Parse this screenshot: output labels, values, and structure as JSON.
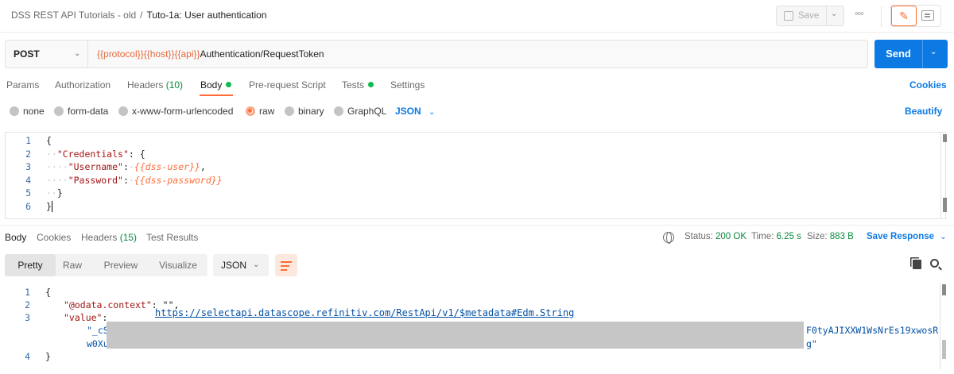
{
  "header": {
    "collection": "DSS REST API Tutorials - old",
    "separator": "/",
    "request_name": "Tuto-1a: User authentication",
    "save_label": "Save"
  },
  "request": {
    "method": "POST",
    "url_vars": [
      "{{protocol}}",
      "{{host}}",
      "{{api}}"
    ],
    "url_path": "Authentication/RequestToken",
    "send_label": "Send"
  },
  "request_tabs": {
    "params": "Params",
    "authorization": "Authorization",
    "headers": "Headers",
    "headers_count": "(10)",
    "body": "Body",
    "prerequest": "Pre-request Script",
    "tests": "Tests",
    "settings": "Settings",
    "cookies": "Cookies"
  },
  "body_types": {
    "none": "none",
    "form_data": "form-data",
    "urlencoded": "x-www-form-urlencoded",
    "raw": "raw",
    "binary": "binary",
    "graphql": "GraphQL",
    "format": "JSON",
    "beautify": "Beautify"
  },
  "request_body": {
    "line_numbers": [
      "1",
      "2",
      "3",
      "4",
      "5",
      "6"
    ],
    "open_brace": "{",
    "credentials_key": "\"Credentials\"",
    "username_key": "\"Username\"",
    "username_value": "{{dss-user}}",
    "password_key": "\"Password\"",
    "password_value": "{{dss-password}}",
    "inner_close": "}",
    "close_brace": "}"
  },
  "response_tabs": {
    "body": "Body",
    "cookies": "Cookies",
    "headers": "Headers",
    "headers_count": "(15)",
    "test_results": "Test Results"
  },
  "response_status": {
    "status_label": "Status:",
    "status_value": "200 OK",
    "time_label": "Time:",
    "time_value": "6.25 s",
    "size_label": "Size:",
    "size_value": "883 B",
    "save_response": "Save Response"
  },
  "response_views": {
    "pretty": "Pretty",
    "raw": "Raw",
    "preview": "Preview",
    "visualize": "Visualize",
    "format": "JSON"
  },
  "response_body": {
    "line_numbers": [
      "1",
      "2",
      "3",
      "4"
    ],
    "open_brace": "{",
    "context_key": "\"@odata.context\"",
    "context_value": "https://selectapi.datascope.refinitiv.com/RestApi/v1/$metadata#Edm.String",
    "value_key": "\"value\"",
    "value_start_1": "\"_cS",
    "value_end_1": "F0tyAJIXXW1WsNrEs19xwosR",
    "value_start_2": "w0Xu",
    "value_end_2": "g\"",
    "close_brace": "}"
  },
  "colors": {
    "accent": "#ff6c37",
    "send": "#0d7ae4",
    "link": "#0d7ae4",
    "status_ok": "#0a8a3d"
  }
}
